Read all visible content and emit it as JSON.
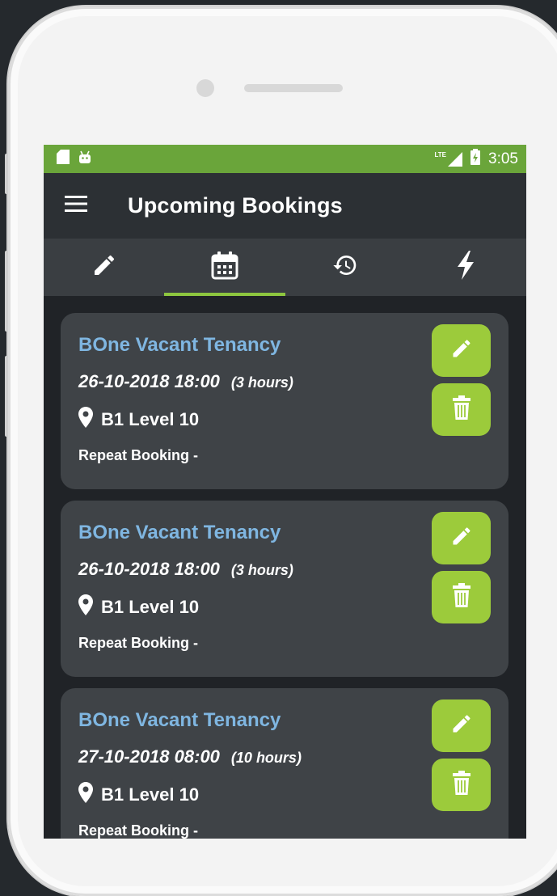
{
  "statusbar": {
    "left_icons": [
      "sd-card-icon",
      "android-icon"
    ],
    "network": "LTE",
    "time": "3:05"
  },
  "appbar": {
    "title": "Upcoming Bookings"
  },
  "tabs": [
    {
      "icon": "pencil-icon",
      "active": false
    },
    {
      "icon": "calendar-icon",
      "active": true
    },
    {
      "icon": "history-icon",
      "active": false
    },
    {
      "icon": "lightning-icon",
      "active": false
    }
  ],
  "colors": {
    "statusbar": "#6aa53a",
    "accent": "#8dc63f",
    "button": "#9ccb3b",
    "title_link": "#7fb6e1",
    "card": "#3f4347",
    "background": "#202327"
  },
  "bookings": [
    {
      "title": "BOne Vacant Tenancy",
      "datetime": "26-10-2018 18:00",
      "duration": "(3 hours)",
      "location": "B1 Level 10",
      "repeat": "Repeat Booking -"
    },
    {
      "title": "BOne Vacant Tenancy",
      "datetime": "26-10-2018 18:00",
      "duration": "(3 hours)",
      "location": "B1 Level 10",
      "repeat": "Repeat Booking -"
    },
    {
      "title": "BOne Vacant Tenancy",
      "datetime": "27-10-2018 08:00",
      "duration": "(10 hours)",
      "location": "B1 Level 10",
      "repeat": "Repeat Booking -"
    }
  ]
}
